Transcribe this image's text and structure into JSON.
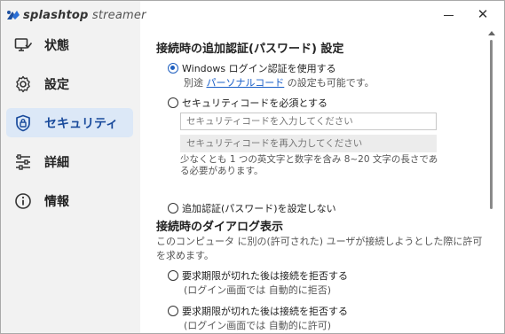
{
  "app": {
    "brand_bold": "splashtop",
    "brand_light": " streamer",
    "close_glyph": "✕"
  },
  "sidebar": {
    "items": [
      {
        "label": "状態",
        "icon": "status-monitor-icon",
        "active": false
      },
      {
        "label": "設定",
        "icon": "gear-icon",
        "active": false
      },
      {
        "label": "セキュリティ",
        "icon": "shield-lock-icon",
        "active": true
      },
      {
        "label": "詳細",
        "icon": "sliders-icon",
        "active": false
      },
      {
        "label": "情報",
        "icon": "info-icon",
        "active": false
      }
    ]
  },
  "main": {
    "auth_title": "接続時の追加認証(パスワード) 設定",
    "option_windows": {
      "label": "Windows ログイン認証を使用する",
      "selected": true,
      "sub_prefix": "別途 ",
      "sub_link": "パーソナルコード",
      "sub_suffix": " の設定も可能です。"
    },
    "option_code": {
      "label": "セキュリティコードを必須とする",
      "selected": false,
      "code_placeholder": "セキュリティコードを入力してください",
      "confirm_placeholder": "セキュリティコードを再入力してください",
      "hint": "少なくとも 1 つの英文字と数字を含み 8~20 文字の長さである必要があります。"
    },
    "option_none": {
      "label": "追加認証(パスワード)を設定しない",
      "selected": false
    },
    "dialog_title": "接続時のダイアログ表示",
    "dialog_desc": "このコンピュータ に別の(許可された) ユーザが接続しようとした際に許可を求めます。",
    "dialog_options": [
      {
        "label": "要求期限が切れた後は接続を拒否する",
        "sub": "(ログイン画面では 自動的に拒否)",
        "selected": false
      },
      {
        "label": "要求期限が切れた後は接続を拒否する",
        "sub": "(ログイン画面では 自動的に許可)",
        "selected": false
      }
    ]
  },
  "colors": {
    "accent": "#1f5fbf",
    "active_bg": "#dce8f7",
    "sidebar_bg": "#f2f2f2"
  }
}
